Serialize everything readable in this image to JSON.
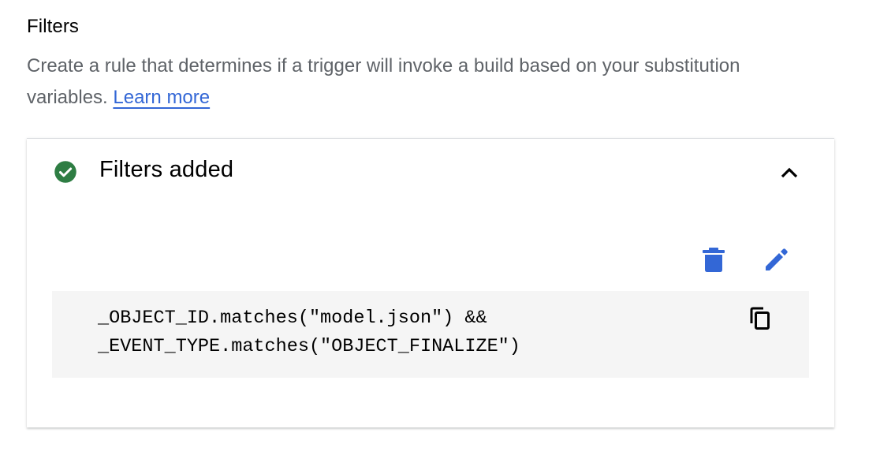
{
  "section": {
    "title": "Filters",
    "description": "Create a rule that determines if a trigger will invoke a build based on your substitution variables.",
    "learn_more_label": "Learn more"
  },
  "panel": {
    "title": "Filters added",
    "status_icon": "check-circle-icon",
    "collapse_icon": "chevron-up-icon",
    "actions": {
      "delete_icon": "delete-icon",
      "edit_icon": "edit-icon",
      "copy_icon": "copy-icon"
    },
    "filter_code": {
      "line1": "_OBJECT_ID.matches(\"model.json\") &&",
      "line2": "_EVENT_TYPE.matches(\"OBJECT_FINALIZE\")"
    }
  },
  "colors": {
    "accent": "#3367d6",
    "success": "#34a853",
    "description_text": "#5f6368",
    "code_background": "#f5f5f5"
  }
}
